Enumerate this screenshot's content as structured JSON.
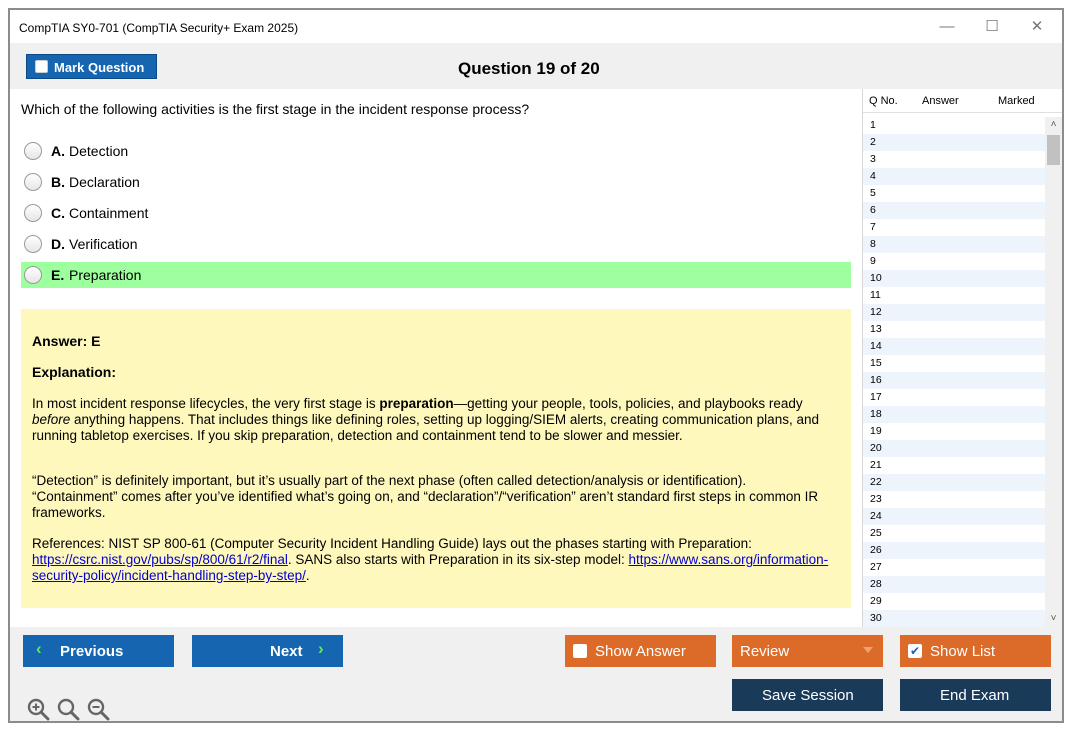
{
  "window": {
    "title": "CompTIA SY0-701 (CompTIA Security+ Exam 2025)",
    "minimize": "—",
    "maximize": "☐",
    "close": "✕"
  },
  "header": {
    "mark_label": "Mark Question",
    "question_title": "Question 19 of 20"
  },
  "question": {
    "text": "Which of the following activities is the first stage in the incident response process?",
    "options": [
      {
        "key": "A.",
        "text": "Detection",
        "correct": false
      },
      {
        "key": "B.",
        "text": "Declaration",
        "correct": false
      },
      {
        "key": "C.",
        "text": "Containment",
        "correct": false
      },
      {
        "key": "D.",
        "text": "Verification",
        "correct": false
      },
      {
        "key": "E.",
        "text": "Preparation",
        "correct": true
      }
    ]
  },
  "explanation": {
    "answer": "Answer: E",
    "heading": "Explanation:",
    "p1_before": "In most incident response lifecycles, the very first stage is ",
    "p1_bold": "preparation",
    "p1_mid": "—getting your people, tools, policies, and playbooks ready ",
    "p1_italic": "before",
    "p1_after": " anything happens. That includes things like defining roles, setting up logging/SIEM alerts, creating communication plans, and running tabletop exercises. If you skip preparation, detection and containment tend to be slower and messier.",
    "p2": "“Detection” is definitely important, but it’s usually part of the next phase (often called detection/analysis or identification). “Containment” comes after you’ve identified what’s going on, and “declaration”/“verification” aren’t standard first steps in common IR frameworks.",
    "p3_before": "References: NIST SP 800-61 (Computer Security Incident Handling Guide) lays out the phases starting with Preparation: ",
    "p3_link1": "https://csrc.nist.gov/pubs/sp/800/61/r2/final",
    "p3_mid": ". SANS also starts with Preparation in its six-step model: ",
    "p3_link2": "https://www.sans.org/information-security-policy/incident-handling-step-by-step/",
    "p3_after": "."
  },
  "sidepanel": {
    "col_qno": "Q No.",
    "col_answer": "Answer",
    "col_marked": "Marked",
    "rows": [
      "1",
      "2",
      "3",
      "4",
      "5",
      "6",
      "7",
      "8",
      "9",
      "10",
      "11",
      "12",
      "13",
      "14",
      "15",
      "16",
      "17",
      "18",
      "19",
      "20",
      "21",
      "22",
      "23",
      "24",
      "25",
      "26",
      "27",
      "28",
      "29",
      "30"
    ],
    "scroll_up": "˄",
    "scroll_down": "˅"
  },
  "footer": {
    "previous": "Previous",
    "next": "Next",
    "show_answer": "Show Answer",
    "review": "Review",
    "show_list": "Show List",
    "save_session": "Save Session",
    "end_exam": "End Exam",
    "chev_left": "‹",
    "chev_right": "›",
    "check": "✔"
  },
  "colors": {
    "primary_blue": "#1565b0",
    "orange": "#dc6a28",
    "dark_navy": "#1a3a5a",
    "correct_green": "#9dff9d",
    "explanation_yellow": "#fff8bd"
  },
  "icons": [
    "zoom-in-icon",
    "zoom-reset-icon",
    "zoom-out-icon"
  ]
}
